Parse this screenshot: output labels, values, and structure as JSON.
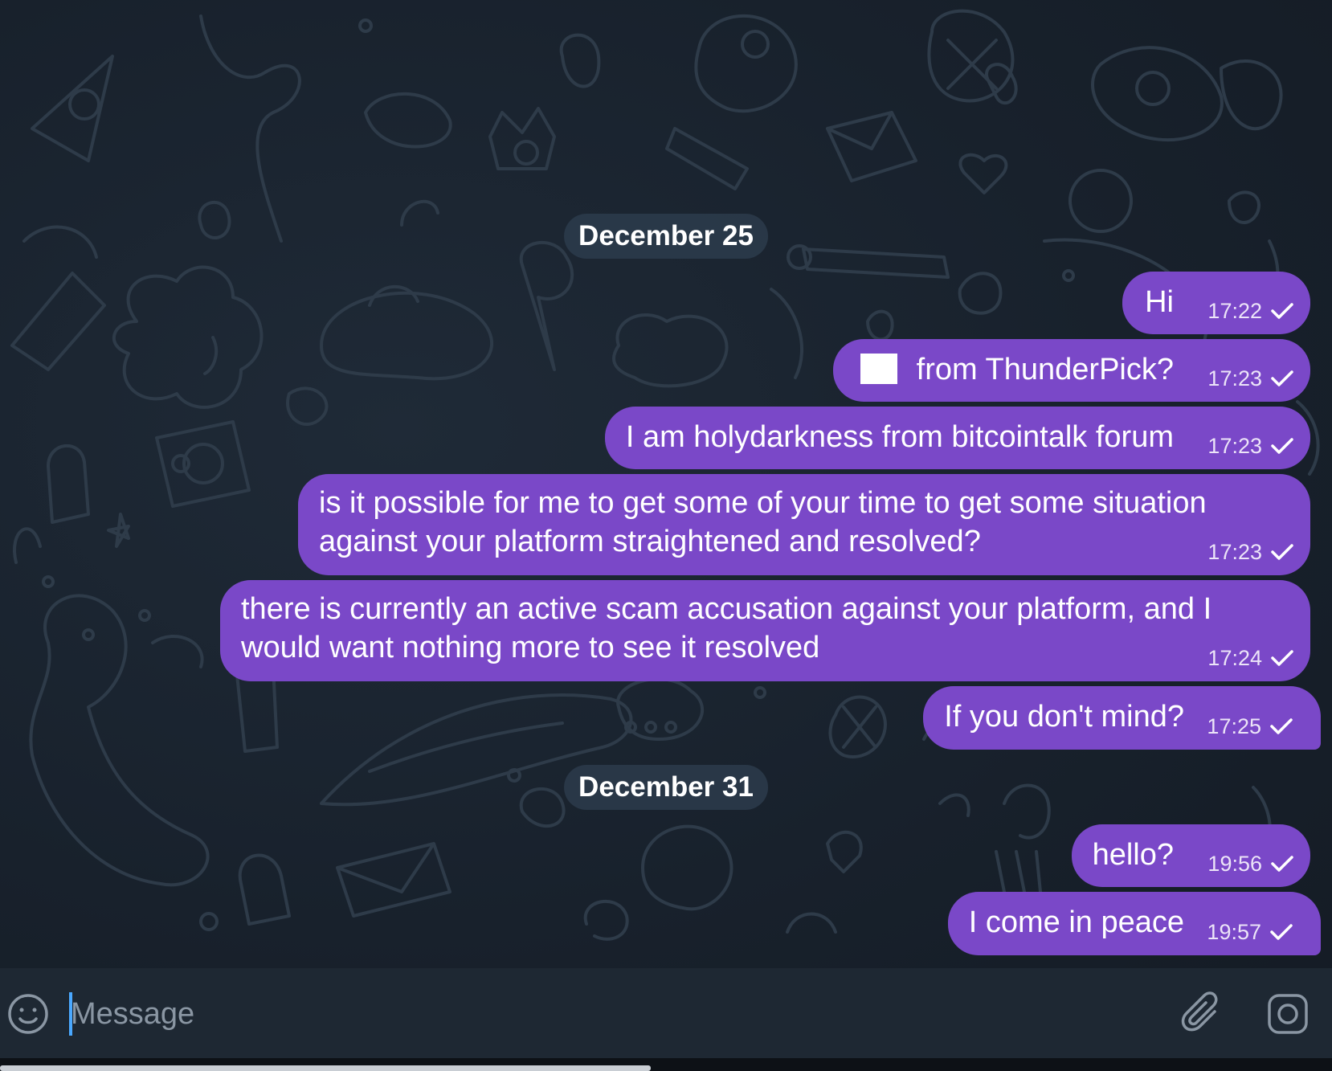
{
  "dates": {
    "first": "December 25",
    "second": "December 31"
  },
  "messages": [
    {
      "text": "Hi",
      "time": "17:22",
      "status": "sent-check"
    },
    {
      "text": "from ThunderPick?",
      "time": "17:23",
      "status": "sent-check",
      "redacted_prefix": true
    },
    {
      "text": "I am holydarkness from bitcointalk forum",
      "time": "17:23",
      "status": "sent-check"
    },
    {
      "line1": "is it possible for me to get some of your time to get some situation",
      "line2": "against your platform straightened and resolved?",
      "time": "17:23",
      "status": "sent-check"
    },
    {
      "line1": "there is currently an active scam accusation against your platform, and I",
      "line2": "would want nothing more to see it resolved",
      "time": "17:24",
      "status": "sent-check"
    },
    {
      "text": "If you don't mind?",
      "time": "17:25",
      "status": "sent-check"
    },
    {
      "text": "hello?",
      "time": "19:56",
      "status": "sent-check"
    },
    {
      "text": "I come in peace",
      "time": "19:57",
      "status": "sent-check"
    }
  ],
  "composer": {
    "placeholder": "Message",
    "emoji_icon": "smile-icon",
    "attach_icon": "paperclip-icon",
    "camera_icon": "camera-icon"
  },
  "colors": {
    "outgoing_bubble": "#7a48c8",
    "background": "#18212c",
    "date_pill": "#2a3a4a",
    "composer": "#1e2833",
    "cursor": "#4aa8ff"
  }
}
